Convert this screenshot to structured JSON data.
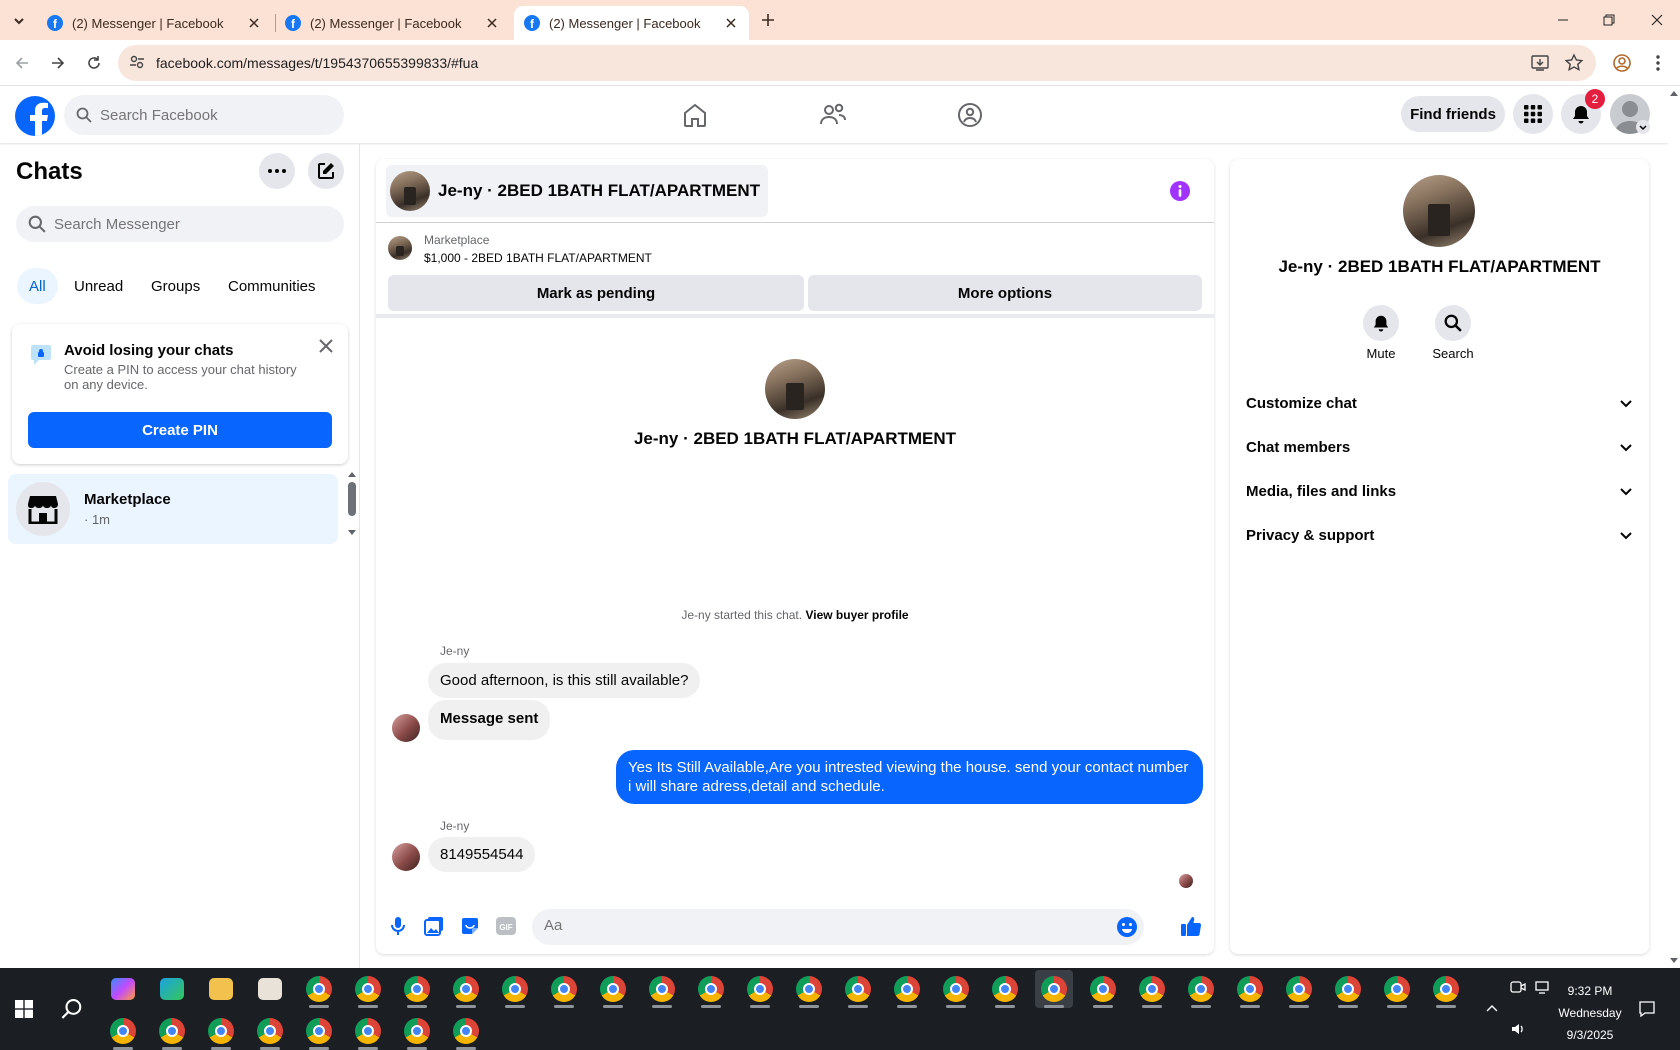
{
  "browser": {
    "tabs": [
      {
        "title": "(2) Messenger | Facebook",
        "active": false
      },
      {
        "title": "(2) Messenger | Facebook",
        "active": false
      },
      {
        "title": "(2) Messenger | Facebook",
        "active": true
      }
    ],
    "url": "facebook.com/messages/t/1954370655399833/#fua"
  },
  "fb_header": {
    "search_placeholder": "Search Facebook",
    "find_friends": "Find friends",
    "notification_count": "2"
  },
  "sidebar": {
    "title": "Chats",
    "search_placeholder": "Search Messenger",
    "filters": [
      "All",
      "Unread",
      "Groups",
      "Communities"
    ],
    "pin_card": {
      "title": "Avoid losing your chats",
      "description": "Create a PIN to access your chat history on any device.",
      "button": "Create PIN"
    },
    "conversations": [
      {
        "name": "Marketplace",
        "subtitle": "· 1m"
      }
    ]
  },
  "chat": {
    "header_name": "Je-ny · 2BED 1BATH FLAT/APARTMENT",
    "marketplace_label": "Marketplace",
    "listing": "$1,000 - 2BED 1BATH FLAT/APARTMENT",
    "mark_pending": "Mark as pending",
    "more_options": "More options",
    "profile_name": "Je-ny · 2BED 1BATH FLAT/APARTMENT",
    "started_text": "Je-ny started this chat.",
    "view_buyer": "View buyer profile",
    "messages": [
      {
        "sender": "Je-ny",
        "text": "Good afternoon, is this still available?"
      },
      {
        "sender": "",
        "text": "Message sent"
      },
      {
        "sender": "me",
        "text": "Yes Its Still Available,Are you intrested viewing the house. send your contact number i will share adress,detail and schedule."
      },
      {
        "sender": "Je-ny",
        "text": "8149554544"
      }
    ],
    "composer_placeholder": "Aa"
  },
  "info_panel": {
    "name": "Je-ny · 2BED 1BATH FLAT/APARTMENT",
    "actions": [
      "Mute",
      "Search"
    ],
    "sections": [
      "Customize chat",
      "Chat members",
      "Media, files and links",
      "Privacy & support"
    ]
  },
  "taskbar": {
    "time": "9:32 PM",
    "day": "Wednesday",
    "date": "9/3/2025"
  },
  "colors": {
    "accent": "#0866ff",
    "chrome_frame": "#fbe2d5",
    "badge": "#e41e3f",
    "info_icon": "#a033ff"
  }
}
